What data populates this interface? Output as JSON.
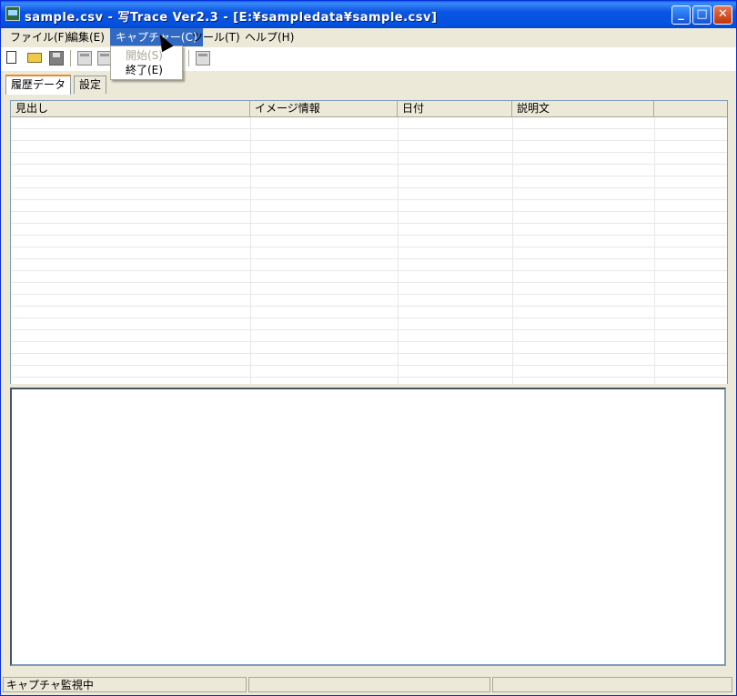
{
  "window": {
    "title": "sample.csv - 写Trace Ver2.3 - [E:¥sampledata¥sample.csv]"
  },
  "title_buttons": {
    "minimize": "_",
    "maximize": "□",
    "close": "✕"
  },
  "menu": [
    {
      "label": "ファイル(F)"
    },
    {
      "label": "編集(E)"
    },
    {
      "label": "キャプチャー(C)"
    },
    {
      "label": "ツール(T)"
    },
    {
      "label": "ヘルプ(H)"
    }
  ],
  "capture_menu": {
    "start": "開始(S)",
    "end": "終了(E)"
  },
  "tabs": [
    {
      "label": "履歴データ"
    },
    {
      "label": "設定"
    }
  ],
  "grid": {
    "columns": [
      "見出し",
      "イメージ情報",
      "日付",
      "説明文",
      ""
    ],
    "rows": []
  },
  "status": {
    "text": "キャプチャ監視中",
    "cell2": "",
    "cell3": ""
  },
  "icons": [
    "new-file-icon",
    "open-folder-icon",
    "save-icon",
    "view-icon",
    "edit-icon",
    "window-icon"
  ],
  "colors": {
    "titlebar": "#0a54e3",
    "menu_highlight": "#316ac5",
    "tab_accent": "#e68b2c"
  }
}
